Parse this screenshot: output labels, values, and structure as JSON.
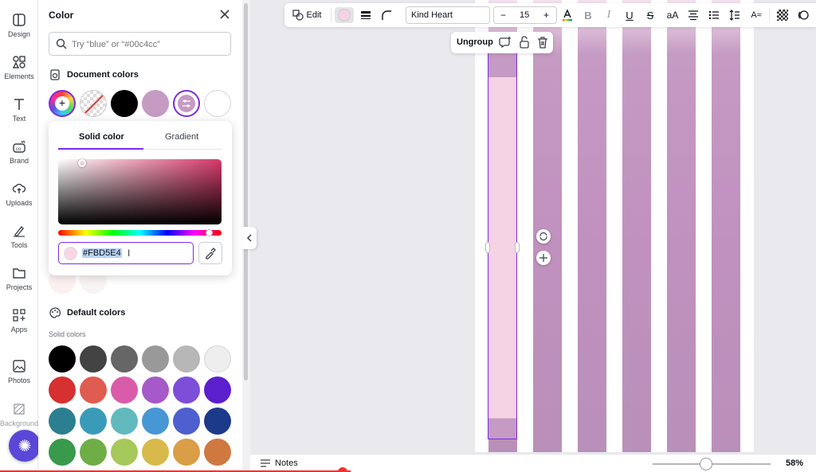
{
  "rail": {
    "items": [
      {
        "label": "Design"
      },
      {
        "label": "Elements"
      },
      {
        "label": "Text"
      },
      {
        "label": "Brand"
      },
      {
        "label": "Uploads"
      },
      {
        "label": "Tools"
      },
      {
        "label": "Projects"
      },
      {
        "label": "Apps"
      },
      {
        "label": "Photos"
      },
      {
        "label": "Background"
      }
    ]
  },
  "panel": {
    "title": "Color",
    "search_placeholder": "Try “blue” or “#00c4cc”",
    "document_colors_label": "Document colors",
    "document_colors": [
      "#000000",
      "#c59ac3",
      "#ffffff"
    ],
    "picker": {
      "tab_solid": "Solid color",
      "tab_gradient": "Gradient",
      "hex_value": "#FBD5E4"
    },
    "default_colors_label": "Default colors",
    "solid_colors_label": "Solid colors",
    "solid_colors": [
      [
        "#000000",
        "#434343",
        "#666666",
        "#999999",
        "#b7b7b7",
        "#eeeeee"
      ],
      [
        "#d63031",
        "#e05b50",
        "#d95caa",
        "#a659c9",
        "#7d4fd9",
        "#5c1fce"
      ],
      [
        "#2c7f91",
        "#3a9bb8",
        "#62b9bd",
        "#4797d4",
        "#4e5fcf",
        "#1c3a8a"
      ],
      [
        "#389a4a",
        "#6fae47",
        "#a7c85a",
        "#d8b94b",
        "#d99e46",
        "#cf7940"
      ]
    ]
  },
  "toolbar": {
    "edit_label": "Edit",
    "font_name": "Kind Heart",
    "font_size": "15",
    "minus": "−",
    "plus": "+",
    "selected_color": "#f5d3e4"
  },
  "context_menu": {
    "ungroup_label": "Ungroup"
  },
  "bottom": {
    "notes_label": "Notes",
    "zoom": "58%"
  },
  "colors": {
    "accent": "#7d2ae8",
    "stripe": "#c59ac3",
    "selected_fill": "#fbd5e4"
  }
}
